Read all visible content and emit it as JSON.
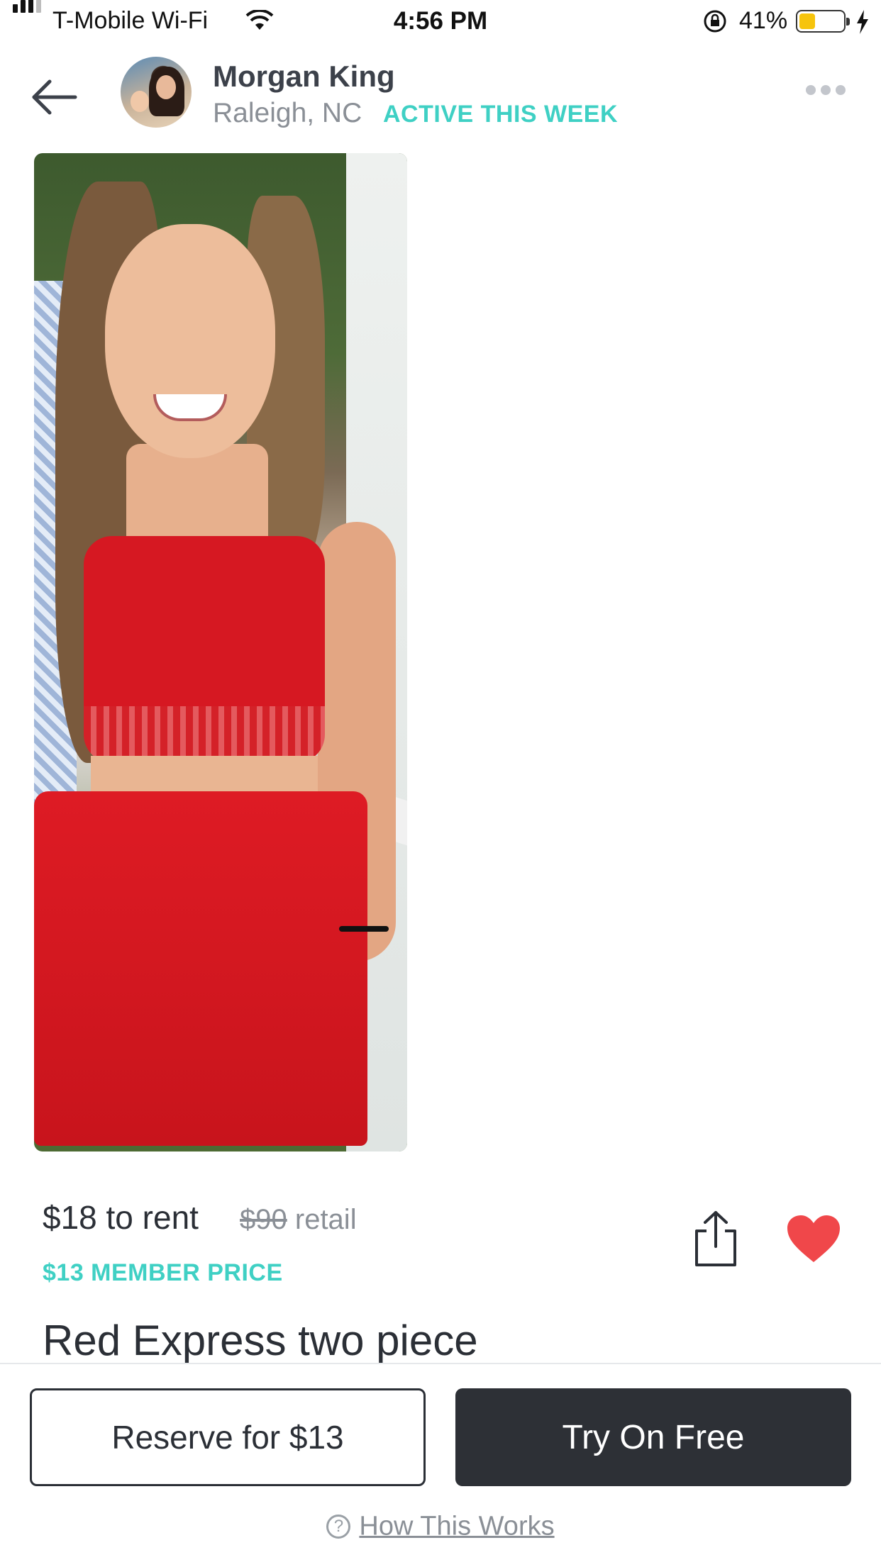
{
  "status_bar": {
    "carrier": "T-Mobile Wi-Fi",
    "time": "4:56 PM",
    "battery_percent": "41%",
    "battery_level": 0.41,
    "icons": [
      "signal-icon",
      "wifi-icon",
      "orientation-lock-icon",
      "battery-icon",
      "charging-bolt-icon"
    ]
  },
  "header": {
    "back_icon": "arrow-left-icon",
    "seller_name": "Morgan King",
    "seller_location": "Raleigh, NC",
    "activity": "ACTIVE THIS WEEK",
    "more_icon": "more-dots-icon"
  },
  "listing": {
    "rent_price": "$18 to rent",
    "retail_price": "$90",
    "retail_label": "retail",
    "member_price": "$13 MEMBER PRICE",
    "title": "Red Express two piece",
    "share_icon": "share-icon",
    "favorite_icon": "heart-icon",
    "favorited": true
  },
  "actions": {
    "reserve_label": "Reserve for $13",
    "try_label": "Try On Free",
    "how_label": "How This Works",
    "help_icon": "question-circle-icon"
  },
  "colors": {
    "accent_teal": "#3fd0c4",
    "heart_red": "#f0474a",
    "dark_button": "#2d3036"
  }
}
